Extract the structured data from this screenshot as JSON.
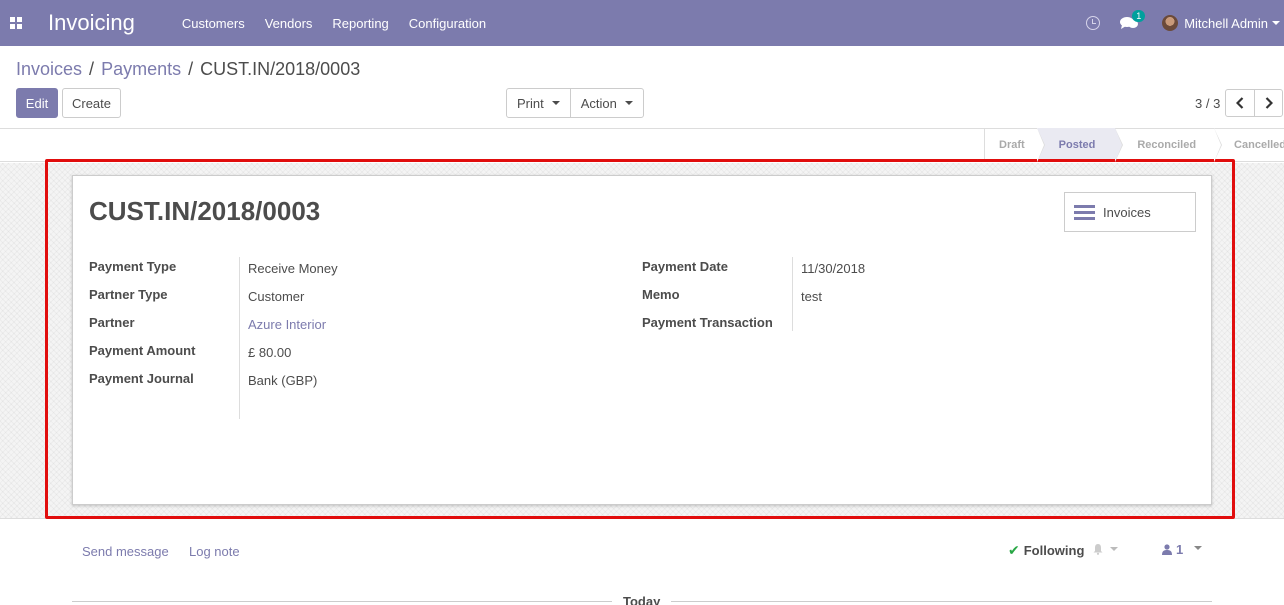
{
  "app": {
    "brand": "Invoicing",
    "menu": [
      "Customers",
      "Vendors",
      "Reporting",
      "Configuration"
    ],
    "notifications_count": "1",
    "user_name": "Mitchell Admin"
  },
  "breadcrumb": {
    "items": [
      "Invoices",
      "Payments"
    ],
    "current": "CUST.IN/2018/0003",
    "separator": "/"
  },
  "toolbar": {
    "edit_label": "Edit",
    "create_label": "Create",
    "print_label": "Print",
    "action_label": "Action",
    "pager": "3 / 3"
  },
  "statusbar": {
    "steps": [
      "Draft",
      "Posted",
      "Reconciled",
      "Cancelled"
    ],
    "active": "Posted"
  },
  "record": {
    "title": "CUST.IN/2018/0003",
    "smart_button_label": "Invoices",
    "left_fields": [
      {
        "label": "Payment Type",
        "value": "Receive Money"
      },
      {
        "label": "Partner Type",
        "value": "Customer"
      },
      {
        "label": "Partner",
        "value": "Azure Interior"
      },
      {
        "label": "Payment Amount",
        "value": "£ 80.00"
      },
      {
        "label": "Payment Journal",
        "value": "Bank (GBP)"
      }
    ],
    "right_fields": [
      {
        "label": "Payment Date",
        "value": "11/30/2018"
      },
      {
        "label": "Memo",
        "value": "test"
      },
      {
        "label": "Payment Transaction",
        "value": ""
      }
    ]
  },
  "chatter": {
    "send_message": "Send message",
    "log_note": "Log note",
    "following": "Following",
    "followers_count": "1",
    "date_separator": "Today"
  },
  "colors": {
    "brand": "#7c7bad",
    "highlight": "#e10d0d",
    "success": "#28a745"
  }
}
